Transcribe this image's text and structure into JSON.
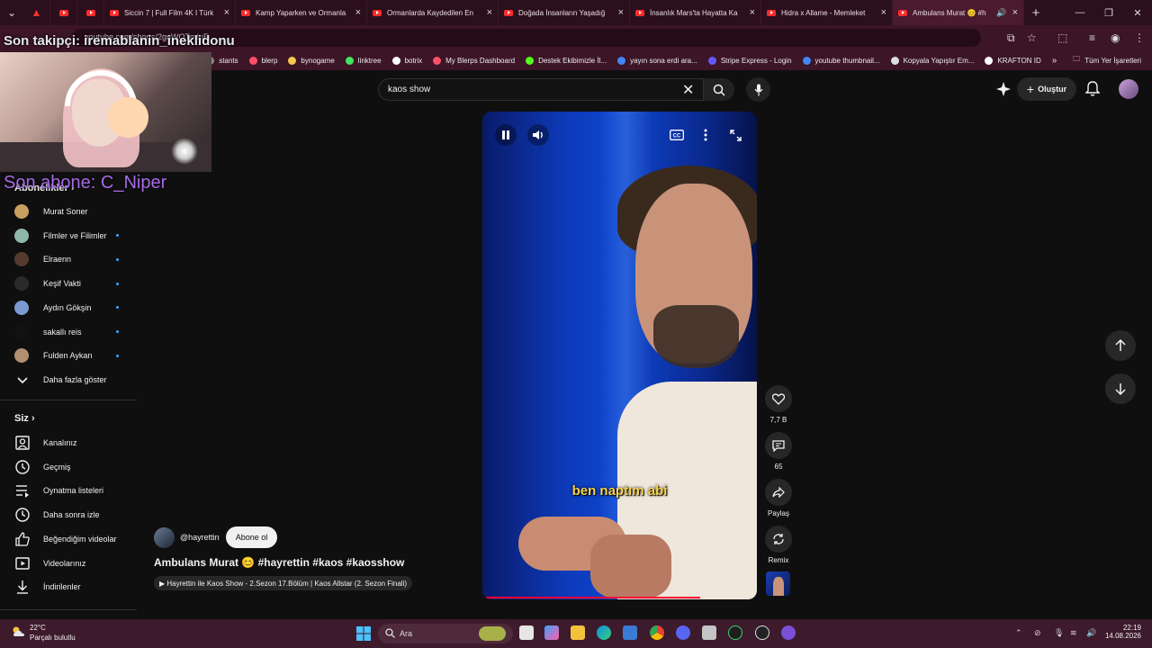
{
  "browser": {
    "tabs": [
      {
        "title": ""
      },
      {
        "title": ""
      },
      {
        "title": "Siccin 7 | Full Film 4K I Türk"
      },
      {
        "title": "Kamp Yaparken ve Ormanla"
      },
      {
        "title": "Ormanlarda Kaydedilen En"
      },
      {
        "title": "Doğada İnsanların Yaşadığ"
      },
      {
        "title": "İnsanlık Mars'ta Hayatta Ka"
      },
      {
        "title": "Hidra x Allame - Memleket"
      },
      {
        "title": "Ambulans Murat 😊 #h"
      }
    ],
    "url": "youtube.com/shorts/2gnWOTmIuE",
    "bookmarks": [
      {
        "label": "stants",
        "color": "#888888"
      },
      {
        "label": "blerp",
        "color": "#ff4e6a"
      },
      {
        "label": "bynogame",
        "color": "#f2c94c"
      },
      {
        "label": "linktree",
        "color": "#43e660"
      },
      {
        "label": "botrix",
        "color": "#ffffff"
      },
      {
        "label": "My Blerps Dashboard",
        "color": "#ff4e6a"
      },
      {
        "label": "Destek Ekibimizle İl...",
        "color": "#53fc18"
      },
      {
        "label": "yayın sona erdi ara...",
        "color": "#4285f4"
      },
      {
        "label": "Stripe Express - Login",
        "color": "#635bff"
      },
      {
        "label": "youtube thumbnail...",
        "color": "#4285f4"
      },
      {
        "label": "Kopyala Yapıştır Em...",
        "color": "#dddddd"
      },
      {
        "label": "KRAFTON ID",
        "color": "#ffffff"
      }
    ],
    "all_bookmarks": "Tüm Yer İşaretleri"
  },
  "overlay": {
    "follower": "Son takipçi: iremablanin_ineklidonu",
    "subscriber": "Son abone: C_Niper"
  },
  "header": {
    "search_value": "kaos show",
    "create_label": "Oluştur"
  },
  "sidebar": {
    "subs_title": "Abonelikler",
    "subs": [
      {
        "name": "Murat Soner",
        "dot": false,
        "color": "#c8a060"
      },
      {
        "name": "Filmler ve Filimler",
        "dot": true,
        "color": "#8fb8a8"
      },
      {
        "name": "Elraenn",
        "dot": true,
        "color": "#553a30"
      },
      {
        "name": "Keşif Vakti",
        "dot": true,
        "color": "#2a2a2a"
      },
      {
        "name": "Aydın Gökşin",
        "dot": true,
        "color": "#7a9ad0"
      },
      {
        "name": "sakallı reis",
        "dot": true,
        "color": "#111111"
      },
      {
        "name": "Fulden Aykan",
        "dot": true,
        "color": "#b09070"
      }
    ],
    "more_label": "Daha fazla göster",
    "you_title": "Siz",
    "you_items": [
      {
        "name": "Kanalınız",
        "icon": "user-icon"
      },
      {
        "name": "Geçmiş",
        "icon": "history-icon"
      },
      {
        "name": "Oynatma listeleri",
        "icon": "playlist-icon"
      },
      {
        "name": "Daha sonra izle",
        "icon": "clock-icon"
      },
      {
        "name": "Beğendiğim videolar",
        "icon": "thumb-up-icon"
      },
      {
        "name": "Videolarınız",
        "icon": "video-icon"
      },
      {
        "name": "İndirilenler",
        "icon": "download-icon"
      }
    ]
  },
  "player": {
    "subtitle": "ben naptım abi",
    "progress": 0.8
  },
  "actions": {
    "likes": "7,7 B",
    "comments": "65",
    "share": "Paylaş",
    "remix": "Remix"
  },
  "video": {
    "channel": "@hayrettin",
    "subscribe": "Abone ol",
    "title": "Ambulans Murat 😊 #hayrettin #kaos #kaosshow",
    "related": "▶ Hayrettin ile Kaos Show - 2.Sezon 17.Bölüm | Kaos Allstar (2. Sezon Finali)"
  },
  "taskbar": {
    "temp": "22°C",
    "condition": "Parçalı bulutlu",
    "search": "Ara",
    "time": "22:19",
    "date": "14.08.2026"
  }
}
